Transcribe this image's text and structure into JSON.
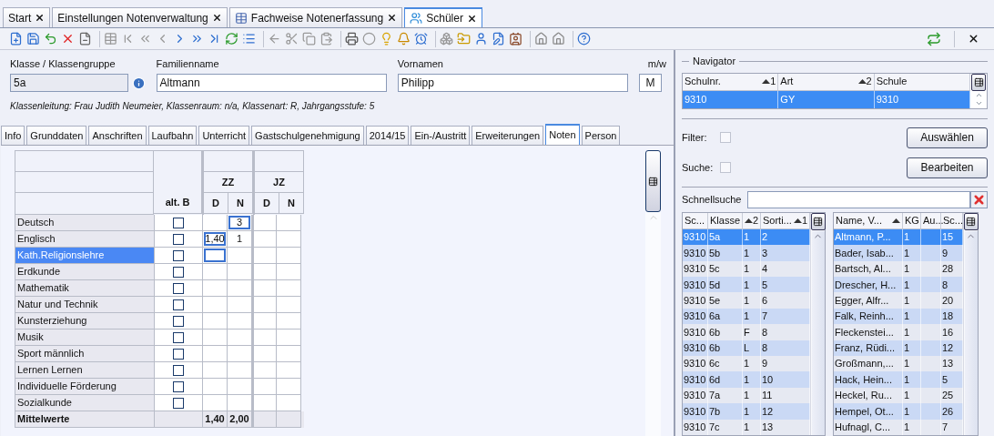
{
  "tabs": [
    {
      "label": "Start",
      "selected": false,
      "kind": "plain"
    },
    {
      "label": "Einstellungen Notenverwaltung",
      "selected": false,
      "kind": "plain"
    },
    {
      "label": "Fachweise Notenerfassung",
      "selected": false,
      "kind": "table"
    },
    {
      "label": "Schüler",
      "selected": true,
      "kind": "people"
    }
  ],
  "form": {
    "fields": [
      {
        "label": "Klasse / Klassengruppe",
        "value": "5a",
        "readonly": true,
        "info": true
      },
      {
        "label": "Familienname",
        "value": "Altmann",
        "readonly": false,
        "info": false
      },
      {
        "label": "Vornamen",
        "value": "Philipp",
        "readonly": false,
        "info": false
      },
      {
        "label": "m/w",
        "value": "M",
        "readonly": false,
        "info": false
      }
    ],
    "info_line": "Klassenleitung: Frau Judith Neumeier, Klassenraum: n/a, Klassenart: R, Jahrgangsstufe: 5"
  },
  "detail_tabs": [
    {
      "label": "Info",
      "selected": false
    },
    {
      "label": "Grunddaten",
      "selected": false
    },
    {
      "label": "Anschriften",
      "selected": false
    },
    {
      "label": "Laufbahn",
      "selected": false
    },
    {
      "label": "Unterricht",
      "selected": false
    },
    {
      "label": "Gastschulgenehmigung",
      "selected": false
    },
    {
      "label": "2014/15",
      "selected": false
    },
    {
      "label": "Ein-/Austritt",
      "selected": false
    },
    {
      "label": "Erweiterungen",
      "selected": false
    },
    {
      "label": "Noten",
      "selected": true
    },
    {
      "label": "Person",
      "selected": false
    }
  ],
  "grades": {
    "alt_b_header": "alt. B",
    "groups": [
      {
        "label": "ZZ",
        "columns": [
          "D",
          "N"
        ]
      },
      {
        "label": "JZ",
        "columns": [
          "D",
          "N"
        ]
      }
    ],
    "rows": [
      {
        "subject": "Deutsch",
        "selected": false,
        "alt_b_checked": false,
        "cells": {
          "zz_n": {
            "value": "3",
            "focused": true
          }
        }
      },
      {
        "subject": "Englisch",
        "selected": false,
        "alt_b_checked": false,
        "cells": {
          "zz_d": {
            "value": "1,40",
            "focused": true
          },
          "zz_n": {
            "value": "1",
            "focused": false
          }
        }
      },
      {
        "subject": "Kath.Religionslehre",
        "selected": true,
        "alt_b_checked": false,
        "cells": {
          "zz_d": {
            "focused": true
          }
        }
      },
      {
        "subject": "Erdkunde",
        "selected": false,
        "alt_b_checked": false,
        "cells": {}
      },
      {
        "subject": "Mathematik",
        "selected": false,
        "alt_b_checked": false,
        "cells": {}
      },
      {
        "subject": "Natur und Technik",
        "selected": false,
        "alt_b_checked": false,
        "cells": {}
      },
      {
        "subject": "Kunsterziehung",
        "selected": false,
        "alt_b_checked": false,
        "cells": {}
      },
      {
        "subject": "Musik",
        "selected": false,
        "alt_b_checked": false,
        "cells": {}
      },
      {
        "subject": "Sport männlich",
        "selected": false,
        "alt_b_checked": false,
        "cells": {}
      },
      {
        "subject": "Lernen Lernen",
        "selected": false,
        "alt_b_checked": false,
        "cells": {}
      },
      {
        "subject": "Individuelle Förderung",
        "selected": false,
        "alt_b_checked": false,
        "cells": {}
      },
      {
        "subject": "Sozialkunde",
        "selected": false,
        "alt_b_checked": false,
        "cells": {}
      }
    ],
    "summary": {
      "label": "Mittelwerte",
      "cells": {
        "zz_d": {
          "value": "1,40"
        },
        "zz_n": {
          "value": "2,00"
        }
      }
    }
  },
  "navigator": {
    "title": "Navigator",
    "columns": [
      {
        "label": "Schulnr.",
        "sort": "1",
        "sorted": true
      },
      {
        "label": "Art",
        "sort": "2",
        "sorted": true
      },
      {
        "label": "Schule",
        "sorted": false
      }
    ],
    "rows": [
      {
        "cells": [
          "9310",
          "GY",
          "9310"
        ],
        "selected": true
      }
    ],
    "filter": {
      "label": "Filter:",
      "checked": false
    },
    "search": {
      "label": "Suche:",
      "checked": false
    },
    "buttons": [
      "Auswählen",
      "Bearbeiten"
    ]
  },
  "quicksearch": {
    "label": "Schnellsuche"
  },
  "classes": {
    "columns": [
      {
        "label": "Sc...",
        "sorted": false
      },
      {
        "label": "Klasse",
        "sorted": false
      },
      {
        "sort": "2",
        "sorted": true
      },
      {
        "label": "Sorti...",
        "sort": "1",
        "sorted": true
      }
    ],
    "rows": [
      {
        "school": "9310",
        "class": "5a",
        "group": "1",
        "order": "2",
        "selected": true
      },
      {
        "school": "9310",
        "class": "5b",
        "group": "1",
        "order": "3",
        "selected": false
      },
      {
        "school": "9310",
        "class": "5c",
        "group": "1",
        "order": "4",
        "selected": false
      },
      {
        "school": "9310",
        "class": "5d",
        "group": "1",
        "order": "5",
        "selected": false
      },
      {
        "school": "9310",
        "class": "5e",
        "group": "1",
        "order": "6",
        "selected": false
      },
      {
        "school": "9310",
        "class": "6a",
        "group": "1",
        "order": "7",
        "selected": false
      },
      {
        "school": "9310",
        "class": "6b",
        "group": "F",
        "order": "8",
        "selected": false
      },
      {
        "school": "9310",
        "class": "6b",
        "group": "L",
        "order": "8",
        "selected": false
      },
      {
        "school": "9310",
        "class": "6c",
        "group": "1",
        "order": "9",
        "selected": false
      },
      {
        "school": "9310",
        "class": "6d",
        "group": "1",
        "order": "10",
        "selected": false
      },
      {
        "school": "9310",
        "class": "7a",
        "group": "1",
        "order": "11",
        "selected": false
      },
      {
        "school": "9310",
        "class": "7b",
        "group": "1",
        "order": "12",
        "selected": false
      },
      {
        "school": "9310",
        "class": "7c",
        "group": "1",
        "order": "13",
        "selected": false
      }
    ]
  },
  "students": {
    "columns": [
      {
        "label": "Name, V...",
        "sorted": true
      },
      {
        "label": "KG",
        "sorted": false
      },
      {
        "label": "Au...",
        "sorted": false
      },
      {
        "label": "Sc...",
        "sorted": false
      }
    ],
    "rows": [
      {
        "name": "Altmann, P...",
        "kg": "1",
        "sc": "15",
        "selected": true
      },
      {
        "name": "Bader, Isab...",
        "kg": "1",
        "sc": "9",
        "selected": false
      },
      {
        "name": "Bartsch, Al...",
        "kg": "1",
        "sc": "28",
        "selected": false
      },
      {
        "name": "Drescher, H...",
        "kg": "1",
        "sc": "8",
        "selected": false
      },
      {
        "name": "Egger, Alfr...",
        "kg": "1",
        "sc": "20",
        "selected": false
      },
      {
        "name": "Falk, Reinh...",
        "kg": "1",
        "sc": "18",
        "selected": false
      },
      {
        "name": "Fleckenstei...",
        "kg": "1",
        "sc": "16",
        "selected": false
      },
      {
        "name": "Franz, Rüdi...",
        "kg": "1",
        "sc": "12",
        "selected": false
      },
      {
        "name": "Großmann,...",
        "kg": "1",
        "sc": "13",
        "selected": false
      },
      {
        "name": "Hack, Hein...",
        "kg": "1",
        "sc": "5",
        "selected": false
      },
      {
        "name": "Heckel, Ru...",
        "kg": "1",
        "sc": "25",
        "selected": false
      },
      {
        "name": "Hempel, Ot...",
        "kg": "1",
        "sc": "26",
        "selected": false
      },
      {
        "name": "Hufnagl, C...",
        "kg": "1",
        "sc": "7",
        "selected": false
      }
    ]
  }
}
